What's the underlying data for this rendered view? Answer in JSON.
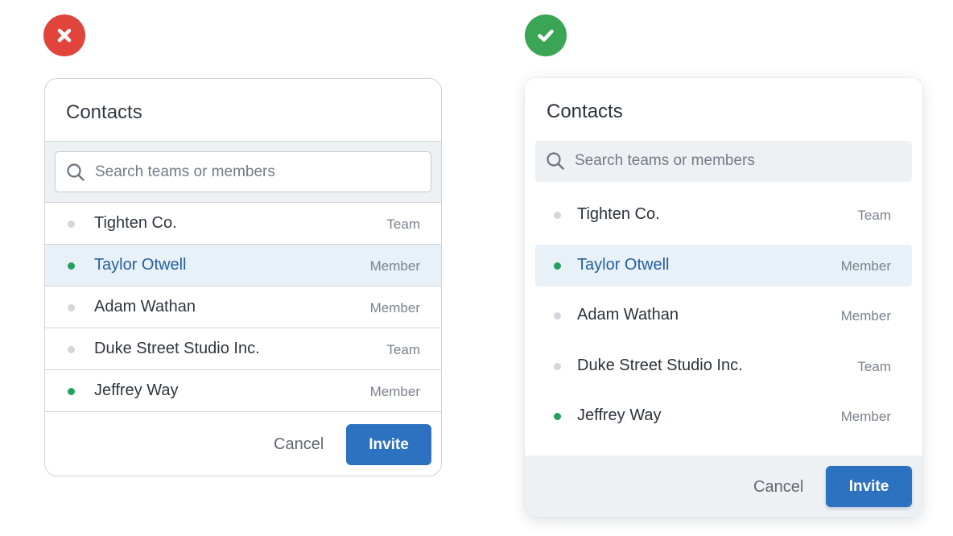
{
  "bad_example": {
    "icon": "x-icon",
    "color": "#e0443a",
    "title": "Contacts",
    "search_placeholder": "Search teams or members",
    "contacts": [
      {
        "name": "Tighten Co.",
        "type": "Team",
        "online": false,
        "selected": false
      },
      {
        "name": "Taylor Otwell",
        "type": "Member",
        "online": true,
        "selected": true
      },
      {
        "name": "Adam Wathan",
        "type": "Member",
        "online": false,
        "selected": false
      },
      {
        "name": "Duke Street Studio Inc.",
        "type": "Team",
        "online": false,
        "selected": false
      },
      {
        "name": "Jeffrey Way",
        "type": "Member",
        "online": true,
        "selected": false
      }
    ],
    "cancel_label": "Cancel",
    "invite_label": "Invite"
  },
  "good_example": {
    "icon": "check-icon",
    "color": "#3aa655",
    "title": "Contacts",
    "search_placeholder": "Search teams or members",
    "contacts": [
      {
        "name": "Tighten Co.",
        "type": "Team",
        "online": false,
        "selected": false
      },
      {
        "name": "Taylor Otwell",
        "type": "Member",
        "online": true,
        "selected": true
      },
      {
        "name": "Adam Wathan",
        "type": "Member",
        "online": false,
        "selected": false
      },
      {
        "name": "Duke Street Studio Inc.",
        "type": "Team",
        "online": false,
        "selected": false
      },
      {
        "name": "Jeffrey Way",
        "type": "Member",
        "online": true,
        "selected": false
      }
    ],
    "cancel_label": "Cancel",
    "invite_label": "Invite"
  },
  "colors": {
    "accent": "#2c72c0",
    "selected_text": "#23609e",
    "selected_bg": "#e9f1f8",
    "online": "#25a060",
    "offline": "#d3d7dc",
    "panel_bg": "#eef1f4"
  }
}
